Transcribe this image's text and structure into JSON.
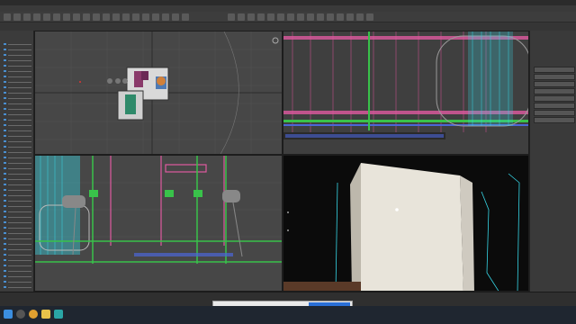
{
  "app": {
    "window_title": "",
    "menu_items": [],
    "toolbar_buttons": 34,
    "ribbon_tabs": []
  },
  "colors": {
    "viewport_bg": "#474747",
    "perspective_bg": "#0b0b0b",
    "wire_pink": "#e05aa0",
    "wire_green": "#39c24a",
    "wire_cyan": "#36d6e6",
    "wall_face": "#e8e4da",
    "notice_button": "#2a6fd6"
  },
  "viewports": [
    {
      "id": "top",
      "label": ""
    },
    {
      "id": "right",
      "label": ""
    },
    {
      "id": "front",
      "label": ""
    },
    {
      "id": "perspective",
      "label": ""
    }
  ],
  "scene_explorer": {
    "rows": 46
  },
  "command_panel": {
    "rows": 8
  },
  "notice": {
    "text": "",
    "button": ""
  },
  "taskbar": {
    "clock": ""
  },
  "icons": [
    "windows-start-icon",
    "search-icon",
    "chrome-icon",
    "folder-icon",
    "max-icon"
  ]
}
